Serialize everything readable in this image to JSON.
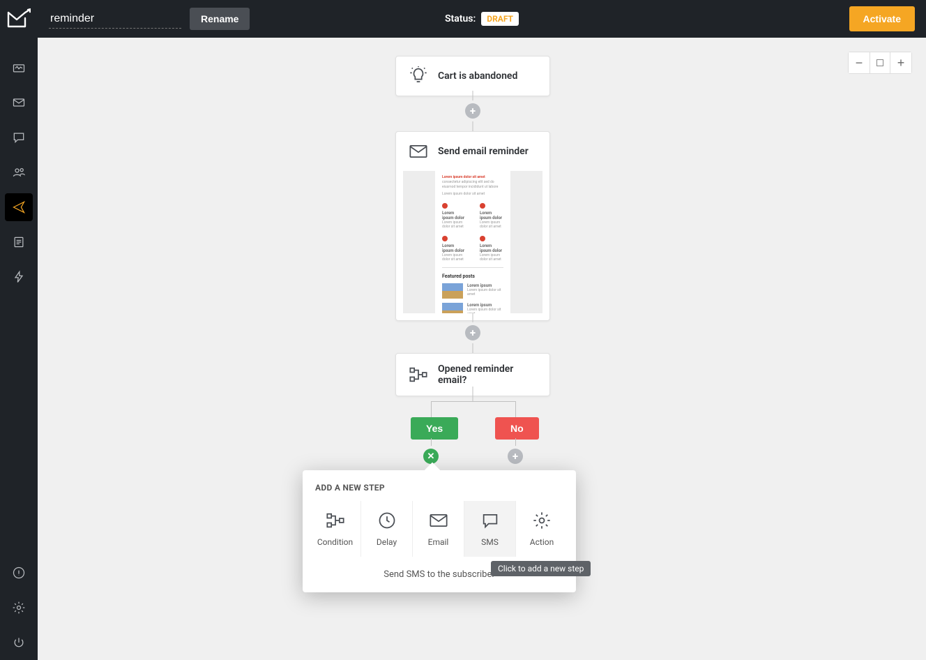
{
  "header": {
    "title_value": "reminder",
    "rename_label": "Rename",
    "status_label": "Status:",
    "status_badge": "DRAFT",
    "activate_label": "Activate"
  },
  "sidebar": {
    "items": [
      {
        "name": "dashboard"
      },
      {
        "name": "mail"
      },
      {
        "name": "chat"
      },
      {
        "name": "contacts"
      },
      {
        "name": "automation",
        "active": true
      },
      {
        "name": "templates"
      },
      {
        "name": "triggers"
      }
    ],
    "footer": [
      {
        "name": "help"
      },
      {
        "name": "settings"
      },
      {
        "name": "power"
      }
    ]
  },
  "zoom": {
    "minus": "−",
    "plus": "+"
  },
  "nodes": {
    "trigger": {
      "title": "Cart is abandoned"
    },
    "email": {
      "title": "Send email reminder"
    },
    "condition": {
      "title": "Opened reminder email?"
    }
  },
  "email_preview": {
    "featured": "Featured posts",
    "item_title": "Lorem ipsum dolor",
    "item_sub": "Lorem ipsum dolor sit amet",
    "post_title": "Lorem ipsum"
  },
  "branches": {
    "yes": "Yes",
    "no": "No"
  },
  "popover": {
    "title": "ADD A NEW STEP",
    "options": [
      {
        "label": "Condition"
      },
      {
        "label": "Delay"
      },
      {
        "label": "Email"
      },
      {
        "label": "SMS"
      },
      {
        "label": "Action"
      }
    ],
    "description": "Send SMS to the subscriber"
  },
  "tooltip": "Click to add a new step"
}
